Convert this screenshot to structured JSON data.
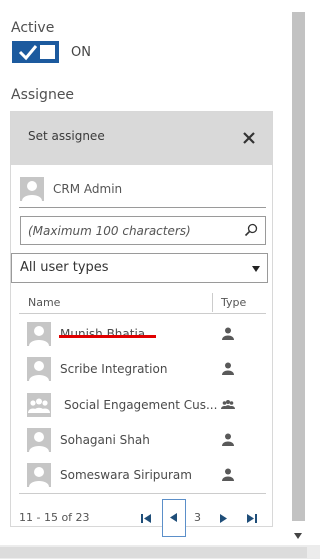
{
  "active": {
    "label": "Active",
    "state": "ON",
    "enabled": true
  },
  "assignee": {
    "label": "Assignee"
  },
  "dialog": {
    "title": "Set assignee",
    "close_icon": "close-icon",
    "current_user": "CRM Admin",
    "search": {
      "placeholder": "(Maximum 100 characters)",
      "value": ""
    },
    "user_type_filter": {
      "selected": "All user types"
    },
    "columns": {
      "name": "Name",
      "type": "Type"
    },
    "users": [
      {
        "name": "Munish Bhatia",
        "type": "user",
        "struck_through": true
      },
      {
        "name": "Scribe Integration",
        "type": "user"
      },
      {
        "name": "Social Engagement Cus...",
        "type": "team"
      },
      {
        "name": "Sohagani Shah",
        "type": "user"
      },
      {
        "name": "Someswara Siripuram",
        "type": "user"
      }
    ],
    "pager": {
      "range": "11 - 15 of 23",
      "current_page": "3"
    }
  },
  "colors": {
    "accent": "#1c5a9e",
    "header_bg": "#d9d9d9",
    "strike": "#e00000",
    "scroll_track": "#c2c2c2"
  }
}
